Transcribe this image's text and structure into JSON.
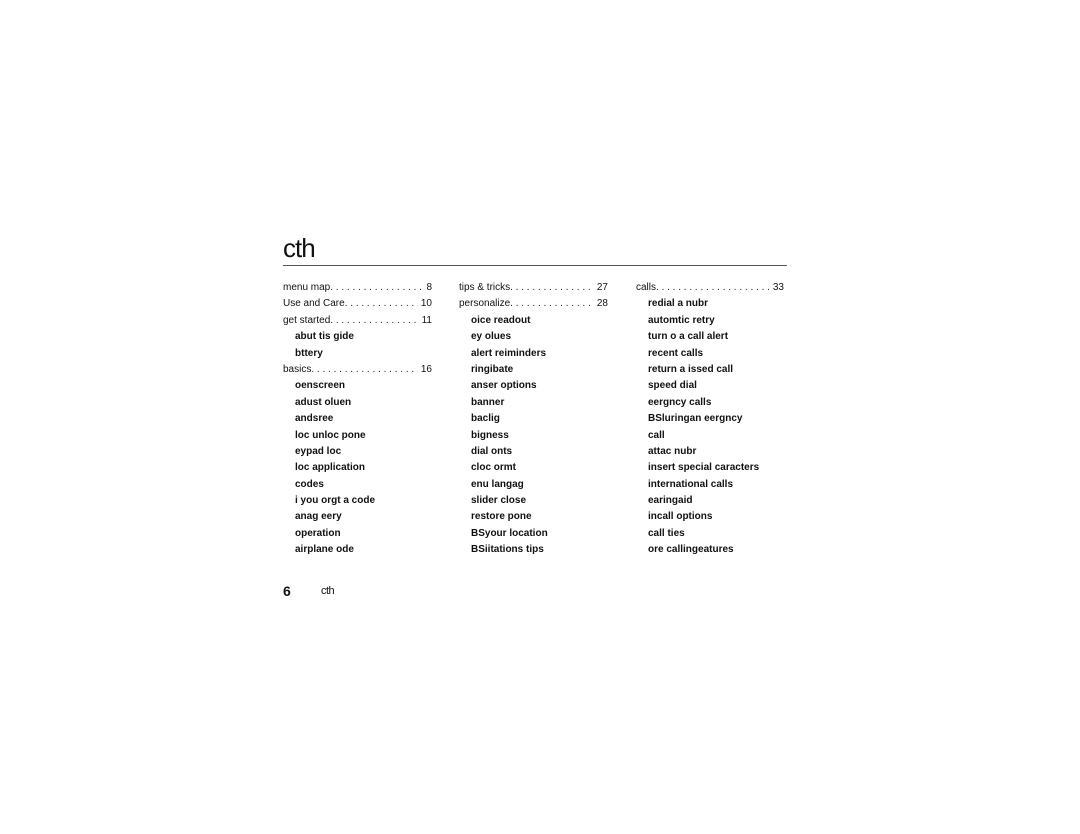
{
  "page": {
    "title": "cth",
    "footer": {
      "page_number": "6",
      "running_title": "cth"
    }
  },
  "columns": [
    {
      "entries": [
        {
          "type": "main",
          "label": "menu map",
          "page": "8"
        },
        {
          "type": "main",
          "label": "Use and Care",
          "page": "10"
        },
        {
          "type": "main",
          "label": "get started",
          "page": "11"
        },
        {
          "type": "sub",
          "label": "abut tis gide"
        },
        {
          "type": "sub",
          "label": "bttery"
        },
        {
          "type": "main",
          "label": "basics",
          "page": "16"
        },
        {
          "type": "sub",
          "label": "oenscreen"
        },
        {
          "type": "sub",
          "label": "adust oluen"
        },
        {
          "type": "sub",
          "label": "andsree"
        },
        {
          "type": "sub",
          "label": "loc  unloc pone"
        },
        {
          "type": "sub",
          "label": "eypad loc"
        },
        {
          "type": "sub",
          "label": "loc application"
        },
        {
          "type": "sub",
          "label": "codes"
        },
        {
          "type": "sub",
          "label": "i you orgt a code"
        },
        {
          "type": "sub",
          "label": "anag eery"
        },
        {
          "type": "sub",
          "label": " operation"
        },
        {
          "type": "sub",
          "label": "airplane ode"
        }
      ]
    },
    {
      "entries": [
        {
          "type": "main",
          "label": "tips & tricks",
          "page": "27"
        },
        {
          "type": "main",
          "label": "personalize",
          "page": "28"
        },
        {
          "type": "sub",
          "label": "oice readout"
        },
        {
          "type": "sub",
          "label": "ey olues"
        },
        {
          "type": "sub",
          "label": "alert reiminders"
        },
        {
          "type": "sub",
          "label": "ringibate"
        },
        {
          "type": "sub",
          "label": "anser options"
        },
        {
          "type": "sub",
          "label": "banner"
        },
        {
          "type": "sub",
          "label": "baclig"
        },
        {
          "type": "sub",
          "label": "bigness"
        },
        {
          "type": "sub",
          "label": "dial onts"
        },
        {
          "type": "sub",
          "label": "cloc ormt"
        },
        {
          "type": "sub",
          "label": "enu langag"
        },
        {
          "type": "sub",
          "label": "slider close"
        },
        {
          "type": "sub",
          "label": "restore pone"
        },
        {
          "type": "sub",
          "label": "BSyour location"
        },
        {
          "type": "sub",
          "label": "BSiitations  tips"
        }
      ]
    },
    {
      "entries": [
        {
          "type": "main",
          "label": "calls",
          "page": "33"
        },
        {
          "type": "sub",
          "label": "redial a nubr"
        },
        {
          "type": "sub",
          "label": "automtic retry"
        },
        {
          "type": "sub",
          "label": "turn o a call alert"
        },
        {
          "type": "sub",
          "label": "recent calls"
        },
        {
          "type": "sub",
          "label": "return a issed call"
        },
        {
          "type": "sub",
          "label": "speed dial"
        },
        {
          "type": "sub",
          "label": "eergncy calls"
        },
        {
          "type": "sub",
          "label": "BSluringan eergncy"
        },
        {
          "type": "sub",
          "label": "call"
        },
        {
          "type": "sub",
          "label": "attac nubr"
        },
        {
          "type": "sub",
          "label": "insert special caracters"
        },
        {
          "type": "sub",
          "label": "international calls"
        },
        {
          "type": "sub",
          "label": "earingaid"
        },
        {
          "type": "sub",
          "label": "incall options"
        },
        {
          "type": "sub",
          "label": "call ties"
        },
        {
          "type": "sub",
          "label": "ore callingeatures"
        }
      ]
    }
  ]
}
